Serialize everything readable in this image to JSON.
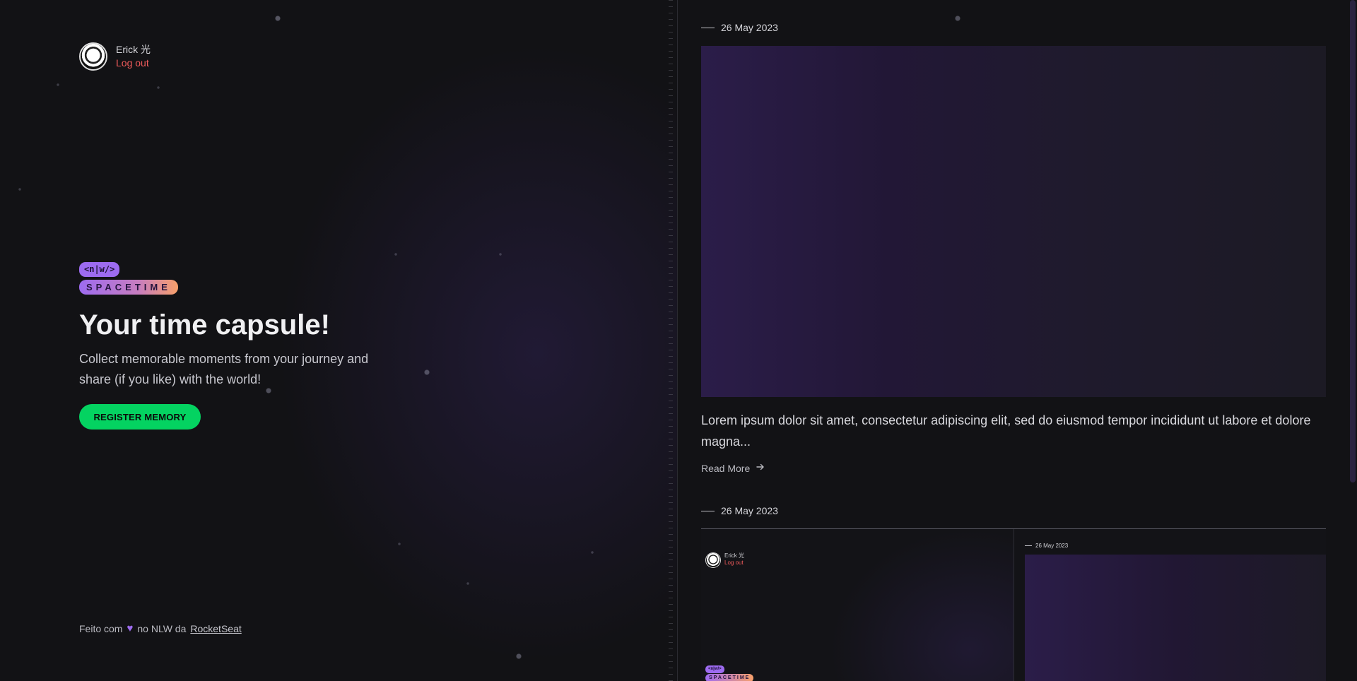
{
  "profile": {
    "name": "Erick 光",
    "logout": "Log out"
  },
  "brand": {
    "badge_top": "<n|w/>",
    "badge_bottom": "SPACETIME"
  },
  "hero": {
    "title": "Your time capsule!",
    "subtitle": "Collect memorable moments from your journey and share (if you like) with the world!",
    "cta": "REGISTER MEMORY"
  },
  "footer": {
    "prefix": "Feito com",
    "middle": "no NLW da",
    "link": "RocketSeat",
    "heart_icon": "heart-icon"
  },
  "memories": [
    {
      "date": "26 May 2023",
      "excerpt": "Lorem ipsum dolor sit amet, consectetur adipiscing elit, sed do eiusmod tempor incididunt ut labore et dolore magna...",
      "read_more": "Read More"
    },
    {
      "date": "26 May 2023",
      "preview": {
        "name": "Erick 光",
        "logout": "Log out",
        "badge_top": "<n|w/>",
        "badge_bottom": "SPACETIME",
        "date": "26 May 2023"
      }
    }
  ],
  "colors": {
    "accent_green": "#04d361",
    "accent_purple": "#9d6bf0",
    "logout_red": "#f05b5b",
    "background": "#121215"
  }
}
